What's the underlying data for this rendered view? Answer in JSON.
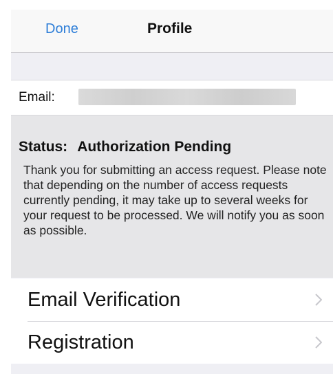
{
  "navbar": {
    "done_label": "Done",
    "title": "Profile"
  },
  "email": {
    "label": "Email:",
    "value_redacted": true
  },
  "status": {
    "label": "Status:",
    "value": "Authorization Pending",
    "message": "Thank you for submitting an access request. Please note that depending on the number of access requests currently pending, it may take up to several weeks for your request to be processed. We will notify you as soon as possible."
  },
  "menu": {
    "items": [
      {
        "label": "Email Verification",
        "icon": "chevron-right-icon"
      },
      {
        "label": "Registration",
        "icon": "chevron-right-icon"
      }
    ]
  },
  "colors": {
    "accent": "#2f7fd8",
    "background": "#efeff4",
    "status_background": "#e6e6e8"
  }
}
